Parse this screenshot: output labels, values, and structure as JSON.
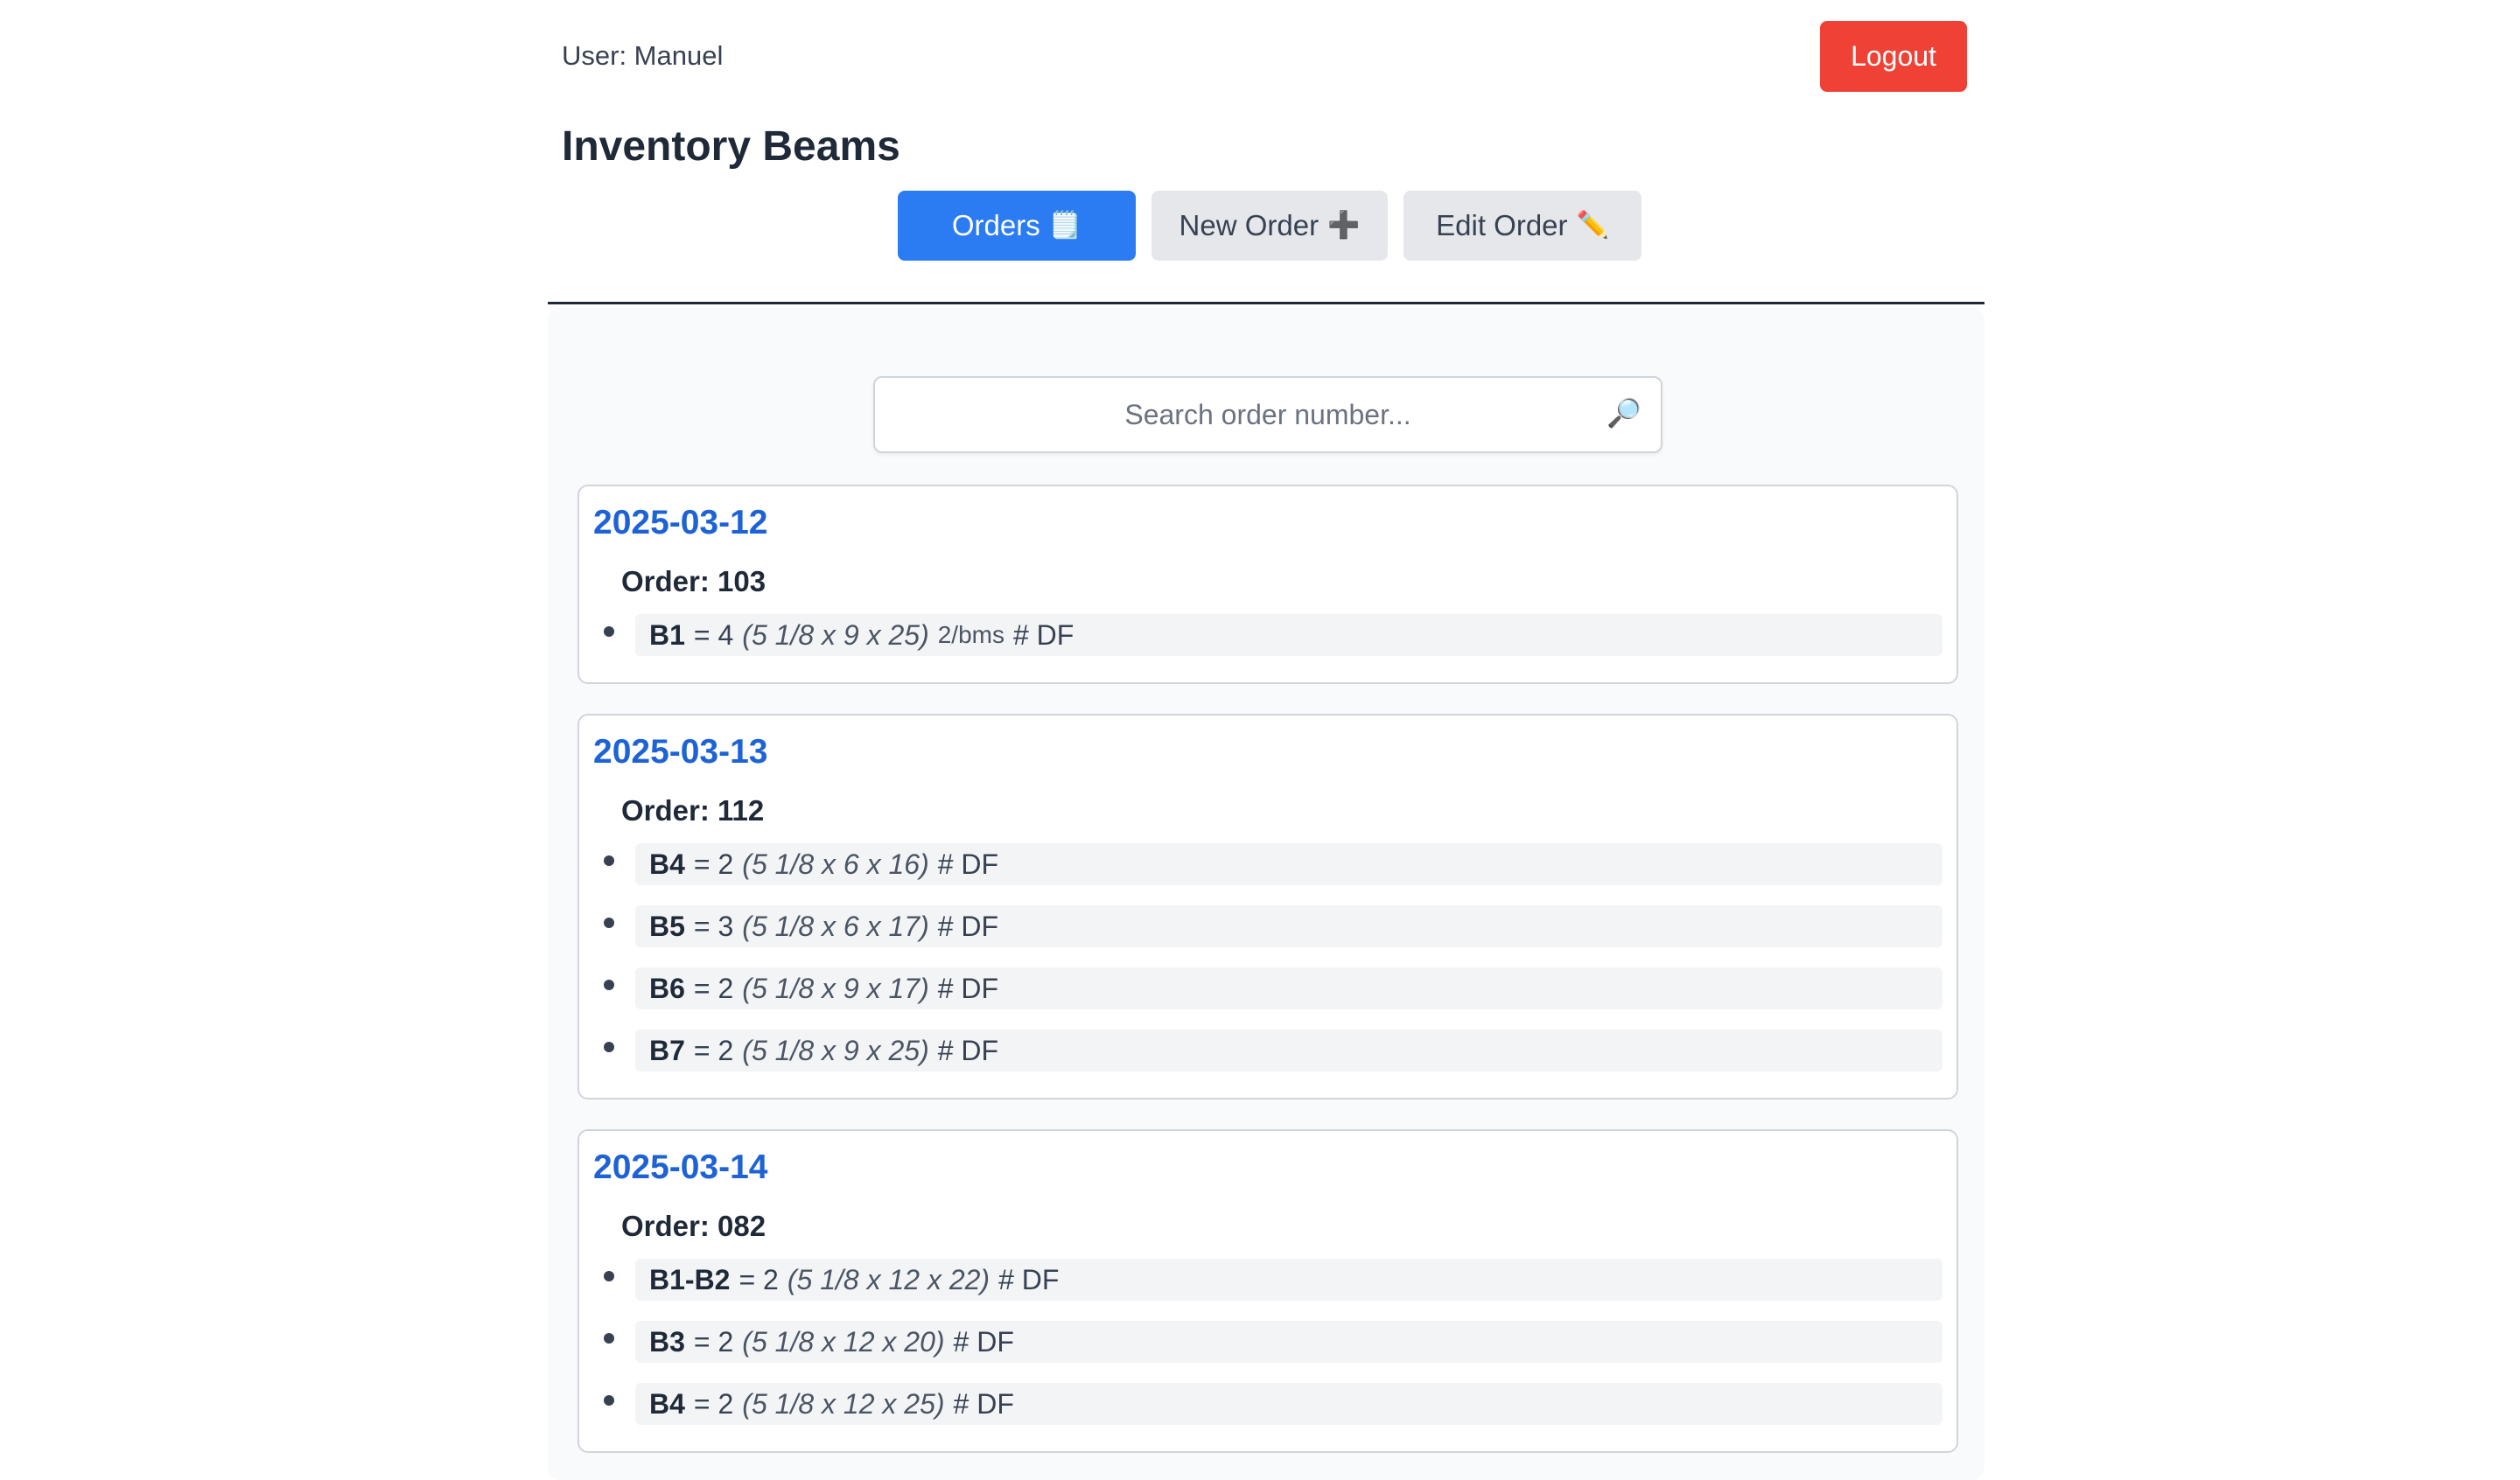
{
  "header": {
    "user_label": "User: Manuel",
    "logout_label": "Logout",
    "app_title": "Inventory Beams"
  },
  "nav": {
    "orders": {
      "label": "Orders",
      "icon": "🗒️"
    },
    "new_order": {
      "label": "New Order",
      "icon": "➕"
    },
    "edit_order": {
      "label": "Edit Order",
      "icon": "✏️"
    }
  },
  "search": {
    "placeholder": "Search order number...",
    "icon": "🔎"
  },
  "colors": {
    "accent": "#2b7bf2",
    "danger": "#ef4135",
    "date": "#1e63d6"
  },
  "orders": [
    {
      "date": "2025-03-12",
      "order_label": "Order: 103",
      "items": [
        {
          "code": "B1",
          "qty": "= 4",
          "dims": "(5 1/8 x 9 x 25)",
          "note": "2/bms",
          "species": "# DF"
        }
      ]
    },
    {
      "date": "2025-03-13",
      "order_label": "Order: 112",
      "items": [
        {
          "code": "B4",
          "qty": "= 2",
          "dims": "(5 1/8 x 6 x 16)",
          "note": "",
          "species": "# DF"
        },
        {
          "code": "B5",
          "qty": "= 3",
          "dims": "(5 1/8 x 6 x 17)",
          "note": "",
          "species": "# DF"
        },
        {
          "code": "B6",
          "qty": "= 2",
          "dims": "(5 1/8 x 9 x 17)",
          "note": "",
          "species": "# DF"
        },
        {
          "code": "B7",
          "qty": "= 2",
          "dims": "(5 1/8 x 9 x 25)",
          "note": "",
          "species": "# DF"
        }
      ]
    },
    {
      "date": "2025-03-14",
      "order_label": "Order: 082",
      "items": [
        {
          "code": "B1-B2",
          "qty": "= 2",
          "dims": "(5 1/8 x 12 x 22)",
          "note": "",
          "species": "# DF"
        },
        {
          "code": "B3",
          "qty": "= 2",
          "dims": "(5 1/8 x 12 x 20)",
          "note": "",
          "species": "# DF"
        },
        {
          "code": "B4",
          "qty": "= 2",
          "dims": "(5 1/8 x 12 x 25)",
          "note": "",
          "species": "# DF"
        }
      ]
    }
  ]
}
